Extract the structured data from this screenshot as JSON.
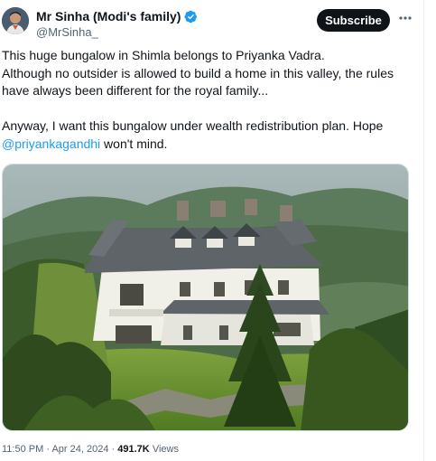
{
  "author": {
    "display_name": "Mr Sinha (Modi's family)",
    "handle": "@MrSinha_",
    "avatar_icon": "avatar-portrait-icon",
    "verified_icon": "verified-badge-icon",
    "verified_color": "#1d9bf0"
  },
  "actions": {
    "subscribe_label": "Subscribe",
    "more_icon": "more-options-icon"
  },
  "tweet": {
    "line1": "This huge bungalow in Shimla belongs to Priyanka Vadra.",
    "line2": "Although no outsider is allowed to build a home in this valley, the rules have always been different for the royal family...",
    "line3": "Anyway, I want this bungalow under wealth redistribution plan. Hope",
    "mention": "@priyankagandhi",
    "line3_end": " won't mind.",
    "mention_color": "#1d9bf0"
  },
  "meta": {
    "time": "11:50 PM",
    "date": "Apr 24, 2024",
    "views_count": "491.7K",
    "views_label": "Views",
    "separator": "·"
  }
}
